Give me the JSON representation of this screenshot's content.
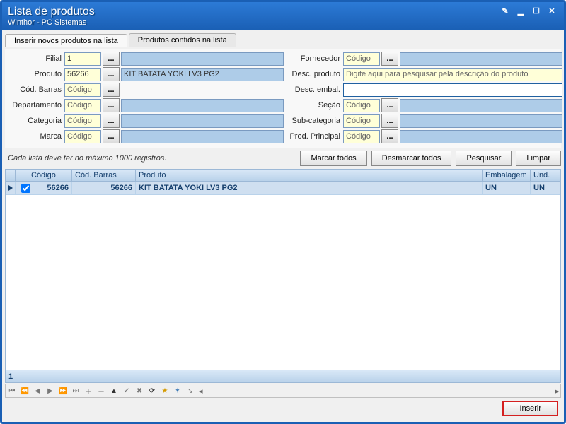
{
  "window": {
    "title": "Lista de produtos",
    "subtitle": "Winthor - PC Sistemas"
  },
  "tabs": {
    "active": "Inserir novos produtos na lista",
    "other": "Produtos contidos na lista"
  },
  "form": {
    "filial": {
      "label": "Filial",
      "code": "1",
      "desc": ""
    },
    "produto": {
      "label": "Produto",
      "code": "56266",
      "desc": "KIT BATATA YOKI LV3 PG2"
    },
    "cod_barras": {
      "label": "Cód. Barras",
      "placeholder": "Código"
    },
    "departamento": {
      "label": "Departamento",
      "placeholder": "Código"
    },
    "categoria": {
      "label": "Categoria",
      "placeholder": "Código"
    },
    "marca": {
      "label": "Marca",
      "placeholder": "Código"
    },
    "fornecedor": {
      "label": "Fornecedor",
      "placeholder": "Código"
    },
    "desc_produto": {
      "label": "Desc. produto",
      "placeholder": "Digite aqui para pesquisar pela descrição do produto"
    },
    "desc_embal": {
      "label": "Desc. embal.",
      "value": ""
    },
    "secao": {
      "label": "Seção",
      "placeholder": "Código"
    },
    "sub_categoria": {
      "label": "Sub-categoria",
      "placeholder": "Código"
    },
    "prod_principal": {
      "label": "Prod. Principal",
      "placeholder": "Código"
    }
  },
  "hint": "Cada lista deve ter no máximo 1000 registros.",
  "buttons": {
    "marcar": "Marcar todos",
    "desmarcar": "Desmarcar todos",
    "pesquisar": "Pesquisar",
    "limpar": "Limpar",
    "inserir": "Inserir"
  },
  "grid": {
    "columns": {
      "codigo": "Código",
      "cod_barras": "Cód. Barras",
      "produto": "Produto",
      "embalagem": "Embalagem",
      "und": "Und."
    },
    "rows": [
      {
        "selected": true,
        "codigo": "56266",
        "cod_barras": "56266",
        "produto": "KIT BATATA YOKI LV3 PG2",
        "embalagem": "UN",
        "und": "UN"
      }
    ],
    "record_count": "1"
  },
  "lookup_label": "..."
}
